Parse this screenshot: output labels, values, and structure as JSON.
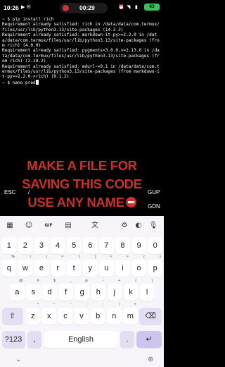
{
  "status": {
    "time": "10:26",
    "notif_icons": "▶ ✉",
    "record_time": "00:29",
    "battery": "63"
  },
  "terminal": {
    "text": "~ $ pip install rich\nRequirement already satisfied: rich in /data/data/com.termux/files/usr/lib/python3.13/site-packages (14.3.3)\nRequirement already satisfied: markdown-it-py>=2.2.0 in /data/data/com.termux/files/usr/lib/python3.13/site-packages (from rich) (4.0.0)\nRequirement already satisfied: pygments<3.0.0,>=2.13.0 in /data/data/com.termux/files/usr/lib/python3.13/site-packages (from rich) (2.19.2)\nRequirement already satisfied: mdurl~=0.1 in /data/data/com.termux/files/usr/lib/python3.13/site-packages (from markdown-it-py>=2.2.0->rich) (0.1.2)\n~ $ nano pred"
  },
  "overlay": {
    "line1": "MAKE A FILE FOR",
    "line2": "SAVING THIS CODE",
    "line3": "USE ANY NAME"
  },
  "extra_keys": {
    "esc": "ESC",
    "slash": "/",
    "pgup": "GUP",
    "pgdn": "GDN"
  },
  "keyboard": {
    "toolbar_icons": [
      "apps-icon",
      "emoji-icon",
      "gif-icon",
      "clipboard-icon",
      "translate-icon",
      "settings-icon",
      "palette-icon",
      "mic-icon"
    ],
    "row1": [
      "1",
      "2",
      "3",
      "4",
      "5",
      "6",
      "7",
      "8",
      "9",
      "0"
    ],
    "row2": [
      "q",
      "w",
      "e",
      "r",
      "t",
      "y",
      "u",
      "i",
      "o",
      "p"
    ],
    "row2_sup": [
      "%",
      "\\",
      "|",
      "=",
      "[",
      "]",
      "<",
      ">",
      "{",
      "}"
    ],
    "row3": [
      "a",
      "s",
      "d",
      "f",
      "g",
      "h",
      "j",
      "k",
      "l"
    ],
    "row3_sup": [
      "@",
      "#",
      "$",
      "_",
      "&",
      "-",
      "+",
      "(",
      ")"
    ],
    "row4": [
      "z",
      "x",
      "c",
      "v",
      "b",
      "n",
      "m"
    ],
    "row4_sup": [
      "*",
      "\"",
      "'",
      ":",
      ";",
      "!",
      "?"
    ],
    "symbols_key": "?123",
    "comma": ",",
    "space_label": "English",
    "period": "."
  }
}
